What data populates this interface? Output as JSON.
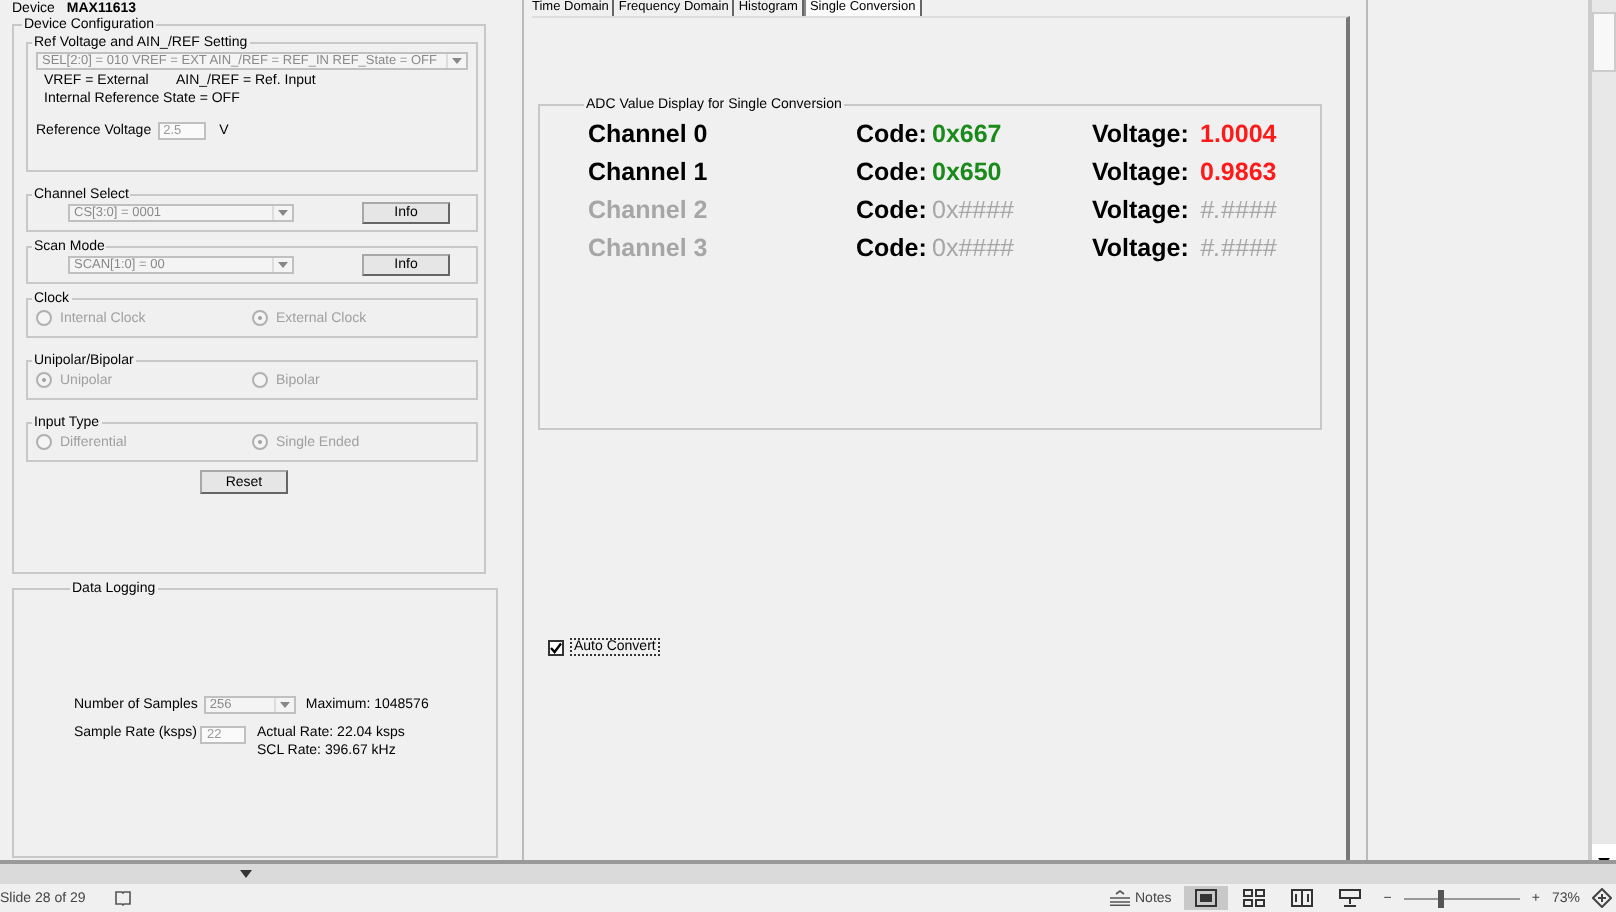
{
  "device": {
    "label": "Device",
    "model": "MAX11613"
  },
  "device_configuration": {
    "title": "Device Configuration",
    "ref_setting": {
      "title": "Ref Voltage and AIN_/REF Setting",
      "dropdown": "SEL[2:0] = 010  VREF = EXT  AIN_/REF = REF_IN  REF_State = OFF",
      "vref": "VREF = External",
      "ain_ref": "AIN_/REF = Ref. Input",
      "internal_state": "Internal Reference State = OFF",
      "reference_voltage": {
        "label": "Reference Voltage",
        "value": "2.5",
        "unit": "V"
      }
    },
    "selects": [
      {
        "title": "Channel Select",
        "dropdown": "CS[3:0] = 0001",
        "button": "Info"
      },
      {
        "title": "Scan Mode",
        "dropdown": "SCAN[1:0] = 00",
        "button": "Info"
      }
    ],
    "radio_groups": [
      {
        "title": "Clock",
        "options": [
          {
            "label": "Internal Clock",
            "selected": false
          },
          {
            "label": "External Clock",
            "selected": true
          }
        ]
      },
      {
        "title": "Unipolar/Bipolar",
        "options": [
          {
            "label": "Unipolar",
            "selected": true
          },
          {
            "label": "Bipolar",
            "selected": false
          }
        ]
      },
      {
        "title": "Input Type",
        "options": [
          {
            "label": "Differential",
            "selected": false
          },
          {
            "label": "Single Ended",
            "selected": true
          }
        ]
      }
    ],
    "reset_button": "Reset"
  },
  "data_logging": {
    "title": "Data Logging",
    "samples": {
      "label": "Number of Samples",
      "value": "256",
      "maximum": "Maximum: 1048576"
    },
    "sample_rate": {
      "label": "Sample Rate (ksps)",
      "value": "22",
      "actual": "Actual Rate:  22.04 ksps",
      "scl": "SCL Rate:  396.67 kHz"
    }
  },
  "tabs": [
    {
      "label": "Time Domain",
      "selected": false
    },
    {
      "label": "Frequency Domain",
      "selected": false
    },
    {
      "label": "Histogram",
      "selected": false
    },
    {
      "label": "Single Conversion",
      "selected": true
    }
  ],
  "adc_display": {
    "title": "ADC Value Display for Single Conversion",
    "channels": [
      {
        "name": "Channel 0",
        "active": true,
        "code_label": "Code:",
        "code": "0x667",
        "voltage_label": "Voltage:",
        "voltage": "1.0004"
      },
      {
        "name": "Channel 1",
        "active": true,
        "code_label": "Code:",
        "code": "0x650",
        "voltage_label": "Voltage:",
        "voltage": "0.9863"
      },
      {
        "name": "Channel 2",
        "active": false,
        "code_label": "Code:",
        "code": "0x####",
        "voltage_label": "Voltage:",
        "voltage": "#.####"
      },
      {
        "name": "Channel 3",
        "active": false,
        "code_label": "Code:",
        "code": "0x####",
        "voltage_label": "Voltage:",
        "voltage": "#.####"
      }
    ]
  },
  "auto_convert": {
    "label": "Auto Convert",
    "checked": true
  },
  "status_bar": {
    "slide": "Slide 28 of 29",
    "notes": "Notes",
    "views": [
      {
        "kind": "normal",
        "selected": true
      },
      {
        "kind": "sorter",
        "selected": false
      },
      {
        "kind": "reading",
        "selected": false
      },
      {
        "kind": "presenter",
        "selected": false
      }
    ],
    "zoom_minus": "−",
    "zoom_plus": "+",
    "zoom": {
      "level": 0.32
    },
    "zoom_reading": "73%"
  }
}
